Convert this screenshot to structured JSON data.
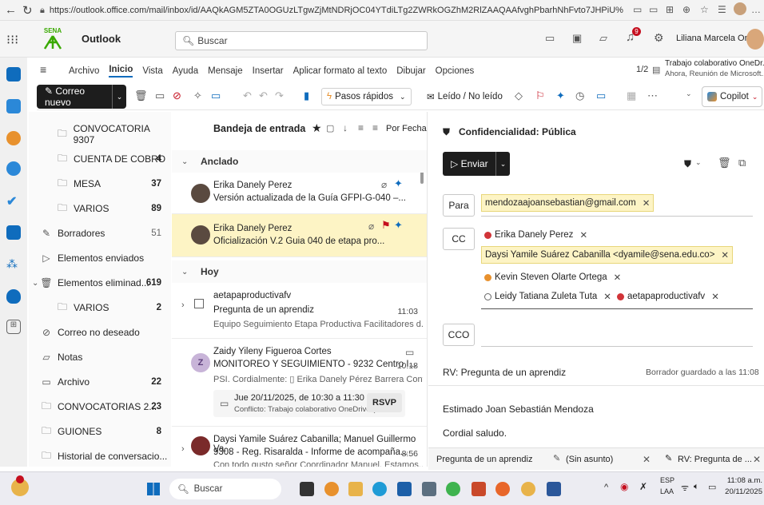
{
  "browser": {
    "url": "https://outlook.office.com/mail/inbox/id/AAQkAGM5ZTA0OGUzLTgwZjMtNDRjOC04YTdiLTg2ZWRkOGZhM2RlZAAQAAfvghPbarhNhFvto7JHPiU%3D"
  },
  "appbar": {
    "brand": "SENA",
    "app_name": "Outlook",
    "search_placeholder": "Buscar",
    "notif_count": "9",
    "user_name": "Liliana Marcela Or..."
  },
  "ribbon": {
    "tabs": [
      "Archivo",
      "Inicio",
      "Vista",
      "Ayuda",
      "Mensaje",
      "Insertar",
      "Aplicar formato al texto",
      "Dibujar",
      "Opciones"
    ],
    "page_indicator": "1/2",
    "reminder_title": "Trabajo colaborativo OneDr...",
    "reminder_sub": "Ahora, Reunión de Microsoft..."
  },
  "toolbar": {
    "new_mail": "Correo nuevo",
    "quick_steps": "Pasos rápidos",
    "read_unread": "Leído / No leído",
    "copilot": "Copilot"
  },
  "folders": [
    {
      "label": "CONVOCATORIA 9307",
      "count": "",
      "icon": "folder-icon",
      "indent": 1
    },
    {
      "label": "CUENTA DE COBRO",
      "count": "4",
      "icon": "folder-icon",
      "indent": 1
    },
    {
      "label": "MESA",
      "count": "37",
      "icon": "folder-icon",
      "indent": 1
    },
    {
      "label": "VARIOS",
      "count": "89",
      "icon": "folder-icon",
      "indent": 1
    },
    {
      "label": "Borradores",
      "count": "51",
      "icon": "pencil-icon",
      "indent": 0,
      "light": true
    },
    {
      "label": "Elementos enviados",
      "count": "",
      "icon": "send-icon",
      "indent": 0
    },
    {
      "label": "Elementos eliminad...",
      "count": "619",
      "icon": "trash-icon",
      "indent": 0,
      "expand": true
    },
    {
      "label": "VARIOS",
      "count": "2",
      "icon": "folder-icon",
      "indent": 1
    },
    {
      "label": "Correo no deseado",
      "count": "",
      "icon": "junk-icon",
      "indent": 0
    },
    {
      "label": "Notas",
      "count": "",
      "icon": "note-icon",
      "indent": 0
    },
    {
      "label": "Archivo",
      "count": "22",
      "icon": "archive-icon",
      "indent": 0
    },
    {
      "label": "CONVOCATORIAS 2...",
      "count": "23",
      "icon": "folder-icon",
      "indent": 0
    },
    {
      "label": "GUIONES",
      "count": "8",
      "icon": "folder-icon",
      "indent": 0
    },
    {
      "label": "Historial de conversacio...",
      "count": "",
      "icon": "folder-icon",
      "indent": 0
    }
  ],
  "list": {
    "title": "Bandeja de entrada",
    "sort": "Por Fecha",
    "pinned_label": "Anclado",
    "today_label": "Hoy",
    "messages": [
      {
        "from": "Erika Danely Perez",
        "subject": "Versión actualizada de la Guía GFPI-G-040 –...",
        "preview": "",
        "time": ""
      },
      {
        "from": "Erika Danely Perez",
        "subject": "Oficialización V.2 Guia 040 de etapa pro...",
        "preview": "",
        "time": ""
      },
      {
        "from": "aetapaproductivafv",
        "subject": "Pregunta de un aprendiz",
        "preview": "Equipo Seguimiento Etapa Productiva Facilitadores d...",
        "time": "11:03"
      },
      {
        "from": "Zaidy Yileny Figueroa Cortes",
        "subject": "MONITOREO Y SEGUIMIENTO - 9232 Centro I...",
        "preview": "PSI. Cordialmente: ▯ Erika Danely Pérez Barrera Cont...",
        "time": "10:18",
        "initial": "Z"
      },
      {
        "from": "Daysi Yamile Suárez Cabanilla; Manuel Guillermo Va...",
        "subject": "9308 - Reg. Risaralda - Informe de acompaña...",
        "preview": "Con todo gusto señor Coordinador Manuel, Estamos...",
        "time": "8:56"
      }
    ],
    "event_date": "Jue 20/11/2025, de 10:30 a 11:30",
    "event_conflict": "Conflicto: Trabajo colaborativo OneDrive (...",
    "rsvp": "RSVP"
  },
  "reading": {
    "confidentiality": "Confidencialidad: Pública",
    "send": "Enviar",
    "to_label": "Para",
    "cc_label": "CC",
    "bcc_label": "CCO",
    "to": [
      "mendozaajoansebastian@gmail.com"
    ],
    "cc": [
      {
        "name": "Erika Danely Perez",
        "color": "#d13438",
        "hl": false
      },
      {
        "name": "Daysi Yamile Suárez Cabanilla <dyamile@sena.edu.co>",
        "color": "",
        "hl": true
      },
      {
        "name": "Kevin Steven Olarte Ortega",
        "color": "#e8912d",
        "hl": false
      },
      {
        "name": "Leidy Tatiana Zuleta Tuta",
        "color": "#666666",
        "hl": false
      },
      {
        "name": "aetapaproductivafv",
        "color": "#d13438",
        "hl": false
      }
    ],
    "subject": "RV: Pregunta de un aprendiz",
    "saved": "Borrador guardado a las 11:08",
    "greeting": "Estimado Joan Sebastián Mendoza",
    "salutation": "Cordial saludo."
  },
  "bottom_tabs": {
    "tab1": "Pregunta de un aprendiz",
    "tab2": "(Sin asunto)",
    "tab3": "RV: Pregunta de ..."
  },
  "taskbar": {
    "search": "Buscar",
    "lang": "ESP",
    "lang2": "LAA",
    "time": "11:08 a.m.",
    "date": "20/11/2025"
  },
  "colors": {
    "accent": "#0f6cbd",
    "pin": "#0f6cbd",
    "flag": "#c50f1f",
    "highlight": "#fdf4c5"
  }
}
